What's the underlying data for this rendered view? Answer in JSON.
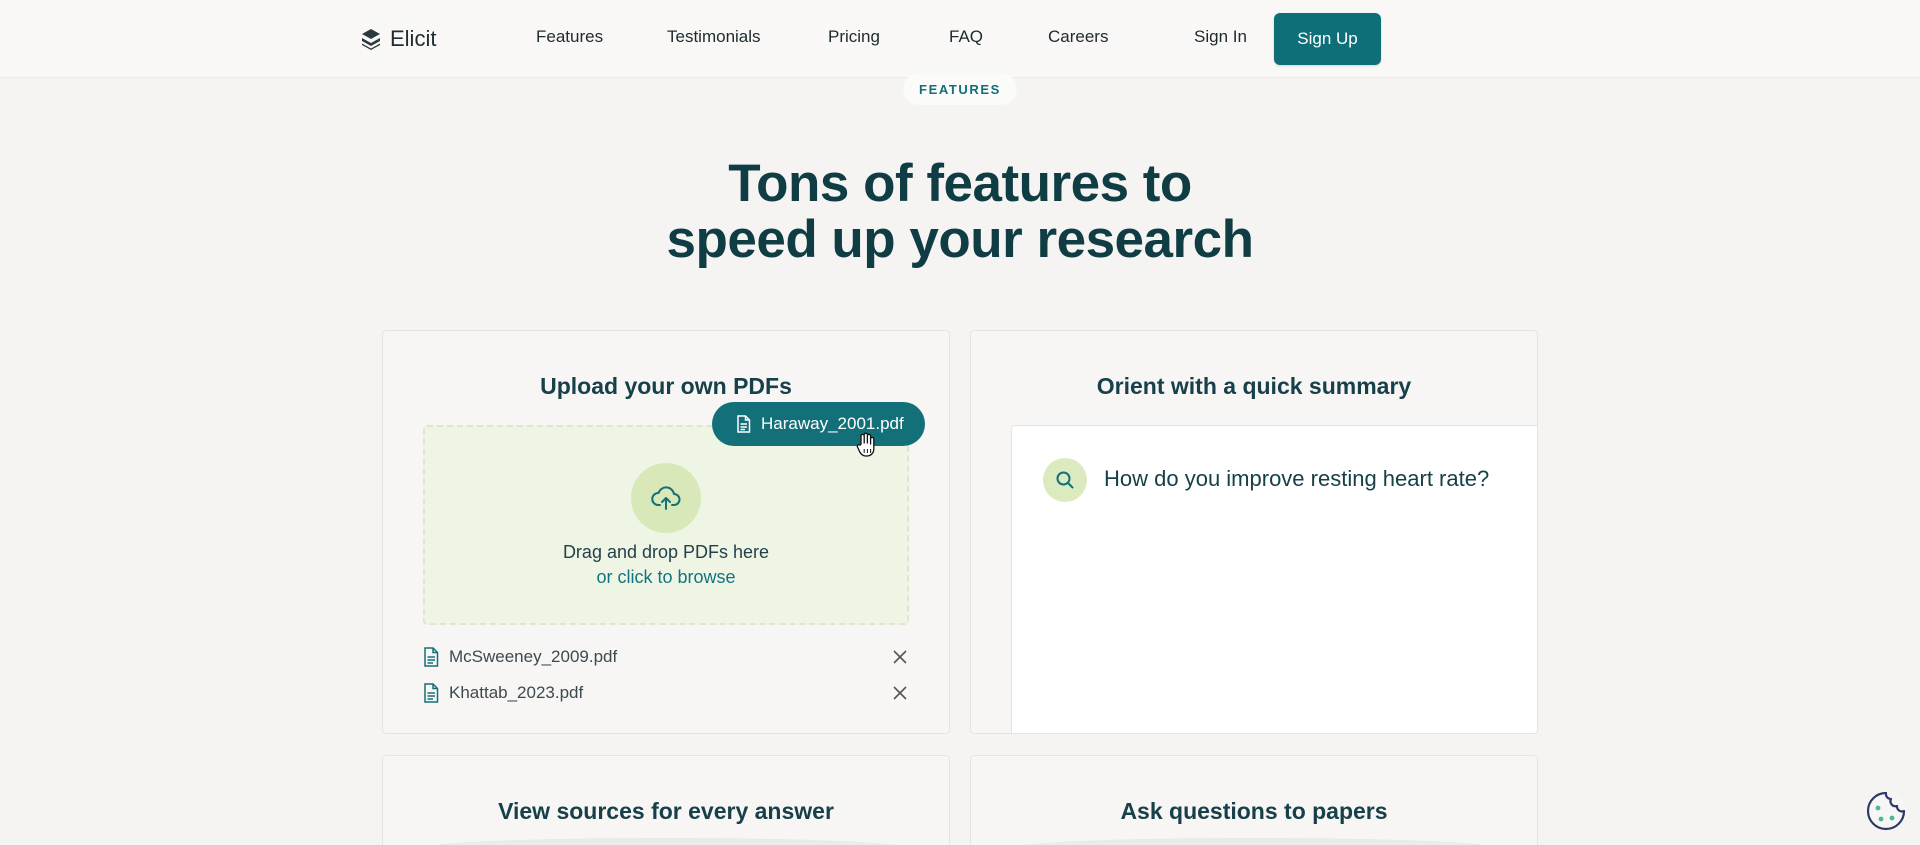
{
  "nav": {
    "brand": "Elicit",
    "links": [
      "Features",
      "Testimonials",
      "Pricing",
      "FAQ",
      "Careers"
    ],
    "sign_in": "Sign In",
    "sign_up": "Sign Up"
  },
  "hero": {
    "badge": "FEATURES",
    "title_line1": "Tons of features to",
    "title_line2": "speed up your research"
  },
  "cards": {
    "upload": {
      "title": "Upload your own PDFs",
      "dragging_file": "Haraway_2001.pdf",
      "drop_text": "Drag and drop PDFs here",
      "browse_text": "or click to browse",
      "files": [
        "McSweeney_2009.pdf",
        "Khattab_2023.pdf"
      ]
    },
    "summary": {
      "title": "Orient with a quick summary",
      "question": "How do you improve resting heart rate?"
    },
    "sources": {
      "title": "View sources for every answer"
    },
    "ask": {
      "title": "Ask questions to papers"
    }
  },
  "colors": {
    "brand": "#0f6f78",
    "heading": "#0f3d43",
    "background": "#f5f4f2",
    "dropzone": "#eff5e5"
  },
  "icons": [
    "elicit-logo-icon",
    "upload-cloud-icon",
    "document-icon",
    "close-icon",
    "search-icon",
    "hand-cursor-icon",
    "cookie-icon"
  ]
}
